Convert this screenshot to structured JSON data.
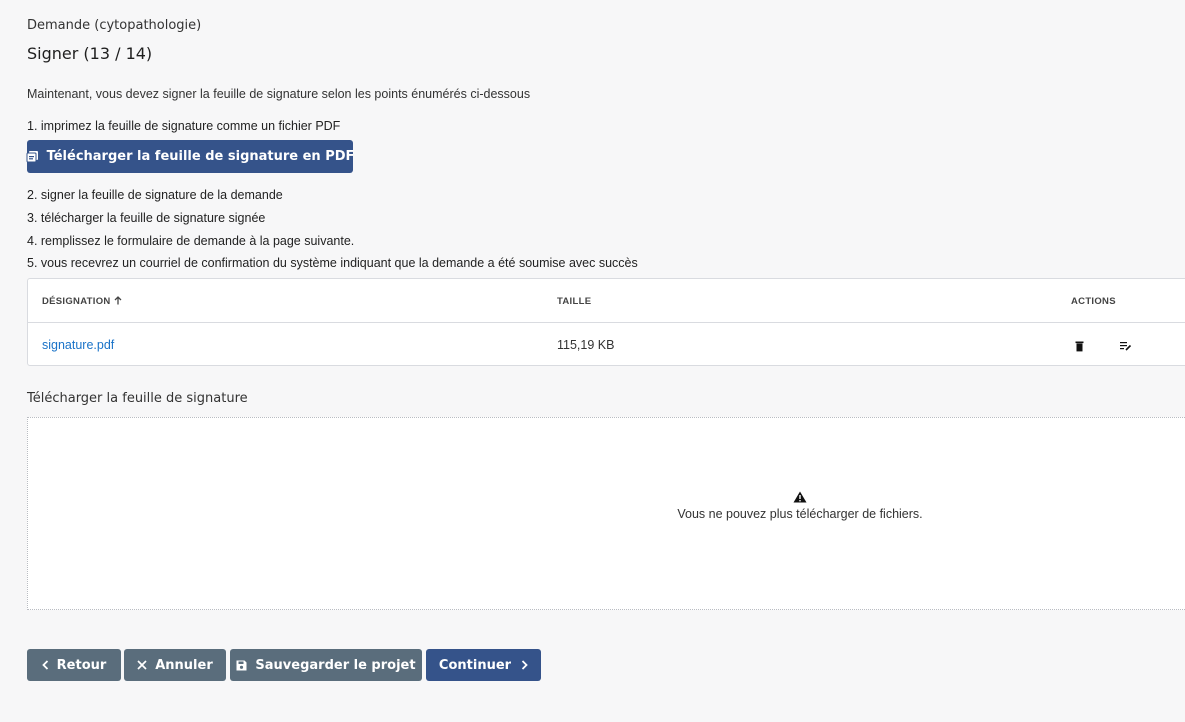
{
  "header": {
    "subtitle": "Demande (cytopathologie)",
    "title": "Signer (13 / 14)"
  },
  "intro": "Maintenant, vous devez signer la feuille de signature selon les points énumérés ci-dessous",
  "steps": [
    "1. imprimez la feuille de signature comme un fichier PDF",
    "2. signer la feuille de signature de la demande",
    "3. télécharger la feuille de signature signée",
    "4. remplissez le formulaire de demande à la page suivante.",
    "5. vous recevrez un courriel de confirmation du système indiquant que la demande a été soumise avec succès"
  ],
  "download_button": {
    "label": "Télécharger la feuille de signature en PDF",
    "icon": "pdf-icon"
  },
  "files_table": {
    "columns": [
      "DÉSIGNATION",
      "TAILLE",
      "ACTIONS"
    ],
    "sort_icon": "arrow-up-icon",
    "rows": [
      {
        "name": "signature.pdf",
        "size": "115,19 KB",
        "actions": [
          "trash-icon",
          "edit-icon"
        ]
      }
    ]
  },
  "upload": {
    "label": "Télécharger la feuille de signature",
    "message": "Vous ne pouvez plus télécharger de fichiers.",
    "icon": "warning-icon"
  },
  "footer_buttons": {
    "back": "Retour",
    "cancel": "Annuler",
    "save": "Sauvegarder le projet",
    "continue": "Continuer"
  },
  "colors": {
    "primary": "#35538a",
    "secondary": "#5a6d7c",
    "link": "#1a73c8",
    "background": "#f7f7f8"
  }
}
